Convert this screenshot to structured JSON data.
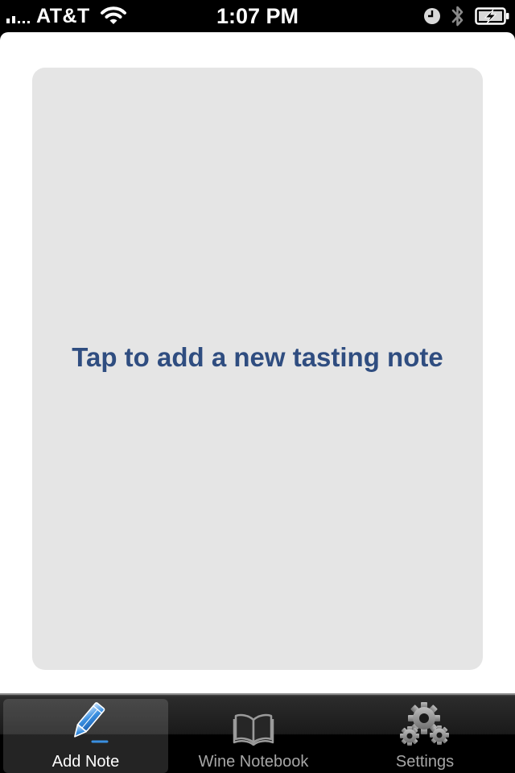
{
  "status_bar": {
    "carrier": "AT&T",
    "time": "1:07 PM",
    "icons": [
      "signal-bars-icon",
      "wifi-icon",
      "clock-icon",
      "bluetooth-icon",
      "battery-charging-icon"
    ]
  },
  "main": {
    "prompt": "Tap to add a new tasting note"
  },
  "tab_bar": {
    "selected": "add_note",
    "tabs": [
      {
        "id": "add_note",
        "label": "Add Note",
        "icon": "pencil-icon"
      },
      {
        "id": "wine_notebook",
        "label": "Wine Notebook",
        "icon": "open-book-icon"
      },
      {
        "id": "settings",
        "label": "Settings",
        "icon": "gears-icon"
      }
    ]
  },
  "colors": {
    "prompt_text": "#2f4d80",
    "panel_background": "#e5e5e5",
    "tab_selected_icon": "#3a8fe0"
  }
}
